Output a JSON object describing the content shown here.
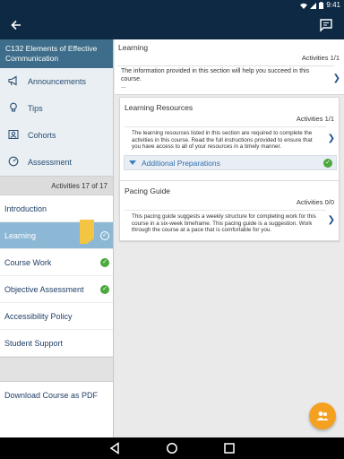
{
  "status": {
    "time": "9:41",
    "wifi_icon": "wifi-icon",
    "battery_icon": "battery-icon"
  },
  "appbar": {
    "back_icon": "arrow-back-icon",
    "chat_icon": "chat-icon"
  },
  "sidebar": {
    "course_title": "C132 Elements of Effective Communication",
    "menu": [
      {
        "label": "Announcements",
        "icon": "megaphone-icon"
      },
      {
        "label": "Tips",
        "icon": "lightbulb-icon"
      },
      {
        "label": "Cohorts",
        "icon": "people-icon"
      },
      {
        "label": "Assessment",
        "icon": "gauge-icon"
      }
    ],
    "activities": "Activities 17 of 17",
    "nav": [
      {
        "label": "Introduction",
        "checked": false,
        "active": false
      },
      {
        "label": "Learning",
        "checked": true,
        "active": true
      },
      {
        "label": "Course Work",
        "checked": true,
        "active": false
      },
      {
        "label": "Objective Assessment",
        "checked": true,
        "active": false
      },
      {
        "label": "Accessibility Policy",
        "checked": false,
        "active": false
      },
      {
        "label": "Student Support",
        "checked": false,
        "active": false
      }
    ],
    "download": "Download Course as PDF"
  },
  "main": {
    "learning": {
      "title": "Learning",
      "activities": "Activities 1/1",
      "description": "The information provided in this section will help you succeed in this course.",
      "ellipsis": "..."
    },
    "cards": [
      {
        "title": "Learning Resources",
        "activities": "Activities 1/1",
        "description": "The learning resources listed in this section are required to complete the activities in this course. Read the full instructions provided to ensure that you have access to all of your resources in a timely manner.",
        "sub_label": "Additional Preparations"
      },
      {
        "title": "Pacing Guide",
        "activities": "Activities 0/0",
        "description": "This pacing guide suggests a weekly structure for completing work for this course in a six-week timeframe. This pacing guide is a suggestion. Work through the course at a pace that is comfortable for you."
      }
    ]
  },
  "colors": {
    "appbar": "#0e2944",
    "header": "#3d6d8a",
    "active": "#8cb8d6",
    "check": "#4aa83c",
    "fab": "#f4a020",
    "bookmark": "#f4c542"
  },
  "fab_icon": "people-icon",
  "navbar_icons": [
    "back-triangle-icon",
    "home-circle-icon",
    "recents-square-icon"
  ]
}
